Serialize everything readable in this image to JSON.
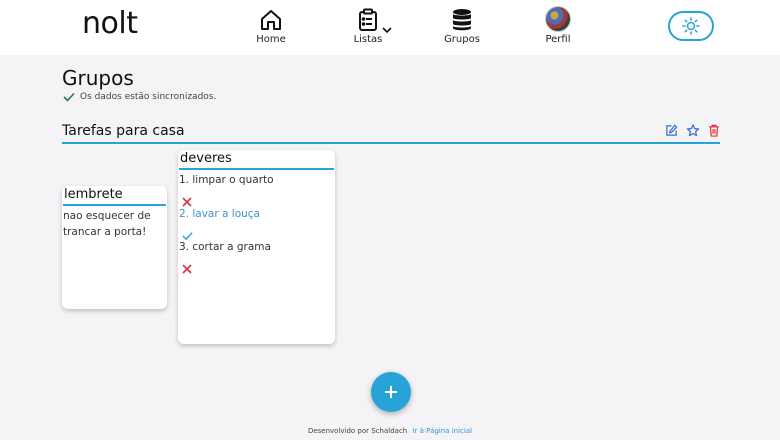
{
  "app": {
    "logo": "nolt"
  },
  "nav": {
    "home": "Home",
    "listas": "Listas",
    "grupos": "Grupos",
    "perfil": "Perfil"
  },
  "page": {
    "title": "Grupos",
    "sync_status": "Os dados estão sincronizados."
  },
  "group": {
    "title": "Tarefas para casa"
  },
  "cards": {
    "lembrete": {
      "title": "lembrete",
      "text": "nao esquecer de trancar a porta!"
    },
    "deveres": {
      "title": "deveres",
      "tasks": [
        {
          "text": "1. limpar o quarto",
          "done": false
        },
        {
          "text": "2. lavar a louça",
          "done": true
        },
        {
          "text": "3. cortar a grama",
          "done": false
        }
      ]
    }
  },
  "footer": {
    "credit": "Desenvolvido por Schaldach",
    "link": "Ir à Página inicial"
  },
  "colors": {
    "accent": "#27a3d8",
    "done_text": "#3b94d2",
    "delete": "#e0303a"
  }
}
